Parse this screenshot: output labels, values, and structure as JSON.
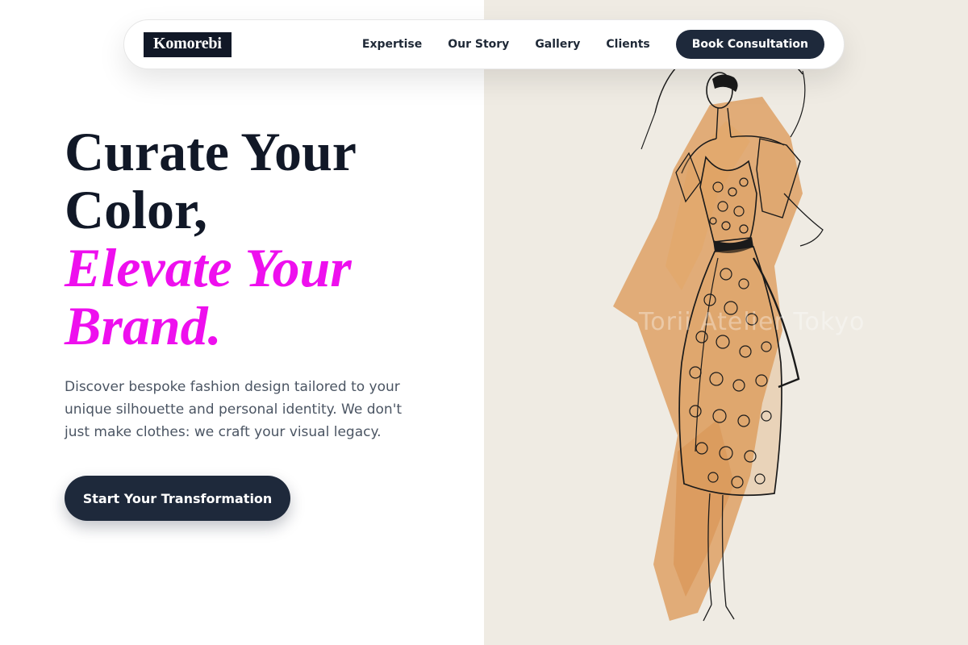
{
  "brand": {
    "logo_text": "Komorebi"
  },
  "nav": {
    "links": [
      "Expertise",
      "Our Story",
      "Gallery",
      "Clients"
    ],
    "cta_label": "Book Consultation"
  },
  "hero": {
    "title_line1": "Curate Your",
    "title_line2": "Color,",
    "accent_line1": "Elevate Your",
    "accent_line2": "Brand.",
    "description": "Discover bespoke fashion design tailored to your unique silhouette and personal identity. We don't just make clothes: we craft your visual legacy.",
    "cta_label": "Start Your Transformation"
  },
  "image": {
    "watermark_text": "Torii Atelier Tokyo"
  },
  "colors": {
    "accent": "#ee0fee",
    "dark": "#1e293b",
    "paper": "#efebe3",
    "wash": "#dc9a5a"
  }
}
